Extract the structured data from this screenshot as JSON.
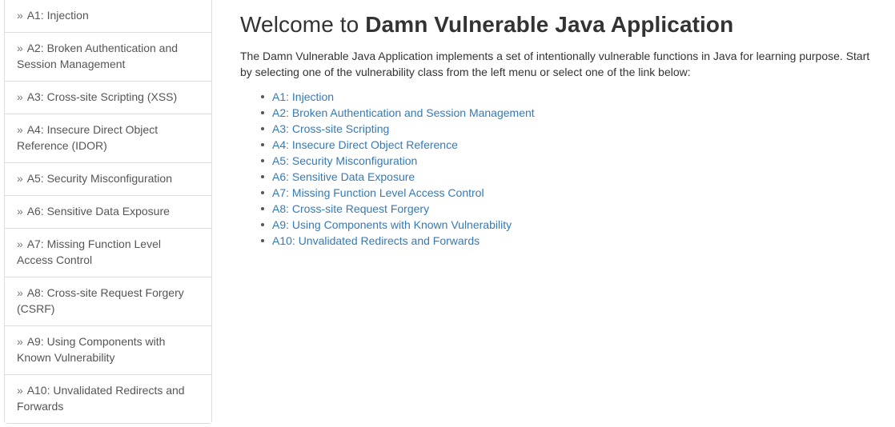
{
  "sidebar": {
    "chevron": "»",
    "items": [
      {
        "label": "A1: Injection"
      },
      {
        "label": "A2: Broken Authentication and Session Management"
      },
      {
        "label": "A3: Cross-site Scripting (XSS)"
      },
      {
        "label": "A4: Insecure Direct Object Reference (IDOR)"
      },
      {
        "label": "A5: Security Misconfiguration"
      },
      {
        "label": "A6: Sensitive Data Exposure"
      },
      {
        "label": "A7: Missing Function Level Access Control"
      },
      {
        "label": "A8: Cross-site Request Forgery (CSRF)"
      },
      {
        "label": "A9: Using Components with Known Vulnerability"
      },
      {
        "label": "A10: Unvalidated Redirects and Forwards"
      }
    ]
  },
  "main": {
    "title_prefix": "Welcome to ",
    "title_strong": "Damn Vulnerable Java Application",
    "intro": "The Damn Vulnerable Java Application implements a set of intentionally vulnerable functions in Java for learning purpose. Start by selecting one of the vulnerability class from the left menu or select one of the link below:",
    "links": [
      {
        "label": "A1: Injection"
      },
      {
        "label": "A2: Broken Authentication and Session Management"
      },
      {
        "label": "A3: Cross-site Scripting"
      },
      {
        "label": "A4: Insecure Direct Object Reference"
      },
      {
        "label": "A5: Security Misconfiguration"
      },
      {
        "label": "A6: Sensitive Data Exposure"
      },
      {
        "label": "A7: Missing Function Level Access Control"
      },
      {
        "label": "A8: Cross-site Request Forgery"
      },
      {
        "label": "A9: Using Components with Known Vulnerability"
      },
      {
        "label": "A10: Unvalidated Redirects and Forwards"
      }
    ]
  },
  "colors": {
    "link": "#337ab7",
    "text": "#333333",
    "sidebar_text": "#555555",
    "border": "#dddddd",
    "background": "#ffffff"
  }
}
